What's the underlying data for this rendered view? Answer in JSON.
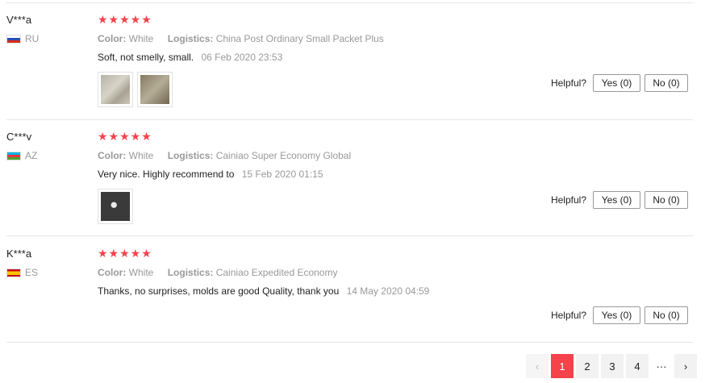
{
  "reviews": [
    {
      "user": "V***a",
      "country": "RU",
      "stars": "★★★★★",
      "color_label": "Color:",
      "color_value": "White",
      "logistics_label": "Logistics:",
      "logistics_value": "China Post Ordinary Small Packet Plus",
      "text": "Soft, not smelly, small.",
      "date": "06 Feb 2020 23:53",
      "helpful_label": "Helpful?",
      "yes_label": "Yes (0)",
      "no_label": "No (0)"
    },
    {
      "user": "C***v",
      "country": "AZ",
      "stars": "★★★★★",
      "color_label": "Color:",
      "color_value": "White",
      "logistics_label": "Logistics:",
      "logistics_value": "Cainiao Super Economy Global",
      "text": "Very nice. Highly recommend to",
      "date": "15 Feb 2020 01:15",
      "helpful_label": "Helpful?",
      "yes_label": "Yes (0)",
      "no_label": "No (0)"
    },
    {
      "user": "K***a",
      "country": "ES",
      "stars": "★★★★★",
      "color_label": "Color:",
      "color_value": "White",
      "logistics_label": "Logistics:",
      "logistics_value": "Cainiao Expedited Economy",
      "text": "Thanks, no surprises, molds are good Quality, thank you",
      "date": "14 May 2020 04:59",
      "helpful_label": "Helpful?",
      "yes_label": "Yes (0)",
      "no_label": "No (0)"
    }
  ],
  "pagination": {
    "prev": "‹",
    "pages": [
      "1",
      "2",
      "3",
      "4"
    ],
    "active": "1",
    "ellipsis": "···",
    "next": "›"
  },
  "colors": {
    "accent": "#f5424b",
    "muted": "#999999"
  }
}
